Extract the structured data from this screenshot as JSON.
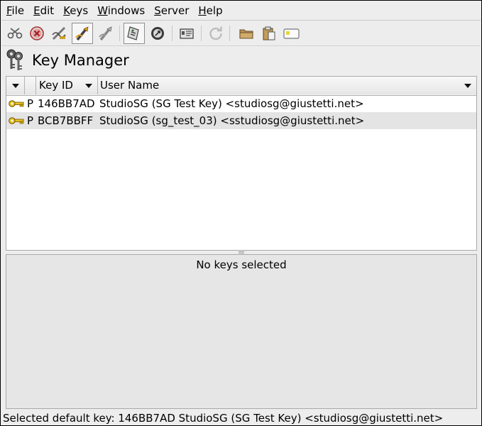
{
  "menu": [
    {
      "label": "File"
    },
    {
      "label": "Edit"
    },
    {
      "label": "Keys"
    },
    {
      "label": "Windows"
    },
    {
      "label": "Server"
    },
    {
      "label": "Help"
    }
  ],
  "toolbar": {
    "icons": [
      "cut-icon",
      "delete-icon",
      "sign-key-icon",
      "generate-key-icon",
      "edit-key-icon",
      "export-key-icon",
      "keyserver-icon",
      "key-info-icon",
      "refresh-icon",
      "open-icon",
      "paste-icon",
      "clipboard-icon"
    ]
  },
  "title": "Key Manager",
  "table": {
    "columns": [
      "",
      "",
      "Key ID",
      "User Name"
    ],
    "rows": [
      {
        "type": "P",
        "key_id": "146BB7AD",
        "user_name": "StudioSG (SG Test Key) <studiosg@giustetti.net>"
      },
      {
        "type": "P",
        "key_id": "BCB7BBFF",
        "user_name": "StudioSG (sg_test_03) <sstudiosg@giustetti.net>"
      }
    ]
  },
  "details": {
    "message": "No keys selected"
  },
  "status": "Selected default key: 146BB7AD StudioSG (SG Test Key) <studiosg@giustetti.net>",
  "colors": {
    "key_gold": "#e8c020",
    "row_alt": "#e4e4e4",
    "window_bg": "#ededed"
  }
}
